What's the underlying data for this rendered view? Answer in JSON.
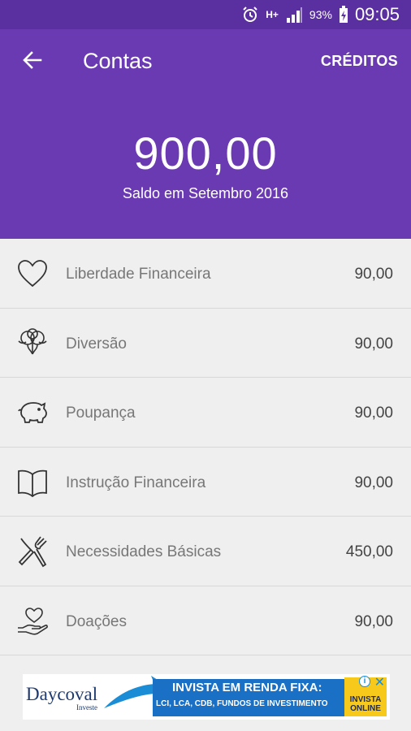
{
  "status_bar": {
    "alarm_icon": "alarm-clock-icon",
    "network_label": "H+",
    "signal_icon": "signal-bars-icon",
    "battery_percent": "93%",
    "battery_icon": "battery-charging-icon",
    "time": "09:05"
  },
  "header": {
    "back_icon": "arrow-left-icon",
    "title": "Contas",
    "action_label": "CRÉDITOS",
    "balance": "900,00",
    "balance_caption": "Saldo em Setembro 2016"
  },
  "accounts": [
    {
      "icon": "heart-icon",
      "label": "Liberdade Financeira",
      "value": "90,00"
    },
    {
      "icon": "balloons-icon",
      "label": "Diversão",
      "value": "90,00"
    },
    {
      "icon": "piggy-bank-icon",
      "label": "Poupança",
      "value": "90,00"
    },
    {
      "icon": "book-icon",
      "label": "Instrução Financeira",
      "value": "90,00"
    },
    {
      "icon": "fork-knife-icon",
      "label": "Necessidades Básicas",
      "value": "450,00"
    },
    {
      "icon": "heart-hand-icon",
      "label": "Doações",
      "value": "90,00"
    }
  ],
  "ad": {
    "logo": "Daycoval",
    "logo_sub": "Investe",
    "headline": "INVISTA EM RENDA FIXA:",
    "subline": "LCI, LCA, CDB, FUNDOS DE INVESTIMENTO",
    "cta": "INVISTA ONLINE",
    "info_icon": "info-icon",
    "close_icon": "close-icon"
  },
  "colors": {
    "status_bar": "#5a2fa0",
    "header": "#6a3ab2",
    "list_background": "#efefef"
  }
}
